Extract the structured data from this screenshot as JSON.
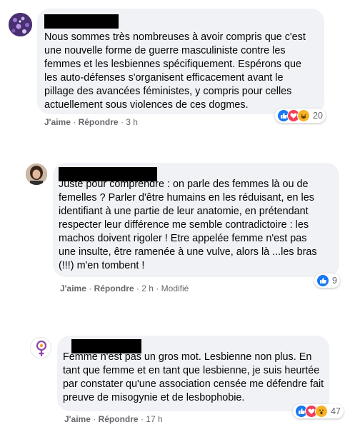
{
  "comments": [
    {
      "text": "Nous sommes très nombreuses à avoir compris que c'est\nune nouvelle forme de guerre masculiniste contre les\nfemmes et les lesbiennes spécifiquement. Espérons que\nles auto-défenses s'organisent efficacement avant le\npillage des avancées féministes, y compris pour celles\nactuellement sous violences de ces dogmes.",
      "like": "J'aime",
      "reply": "Répondre",
      "time": "3 h",
      "sep": "·",
      "reaction_count": "20",
      "reactions": [
        "like-icon",
        "love-icon",
        "haha-icon"
      ]
    },
    {
      "text": "Juste pour comprendre : on parle des femmes là ou de\nfemelles ? Parler d'être humains en les réduisant, en les\nidentifiant à une partie de leur anatomie, en prétendant\nrespecter leur différence me semble contradictoire : les\nmachos doivent rigoler ! Etre appelée femme n'est pas\nune insulte, être ramenée à une vulve, alors là ...les bras\n(!!!) m'en tombent !",
      "like": "J'aime",
      "reply": "Répondre",
      "time": "2 h",
      "edited": "Modifié",
      "sep": "·",
      "reaction_count": "9",
      "reactions": [
        "like-icon"
      ]
    },
    {
      "text": "Femme n'est pas un gros mot. Lesbienne non plus. En\ntant que femme et en tant que lesbienne, je suis heurtée\npar constater qu'une association censée me défendre fait\npreuve de misogynie et de lesbophobie.",
      "like": "J'aime",
      "reply": "Répondre",
      "time": "17 h",
      "sep": "·",
      "reaction_count": "47",
      "reactions": [
        "like-icon",
        "love-icon",
        "wow-icon"
      ]
    }
  ],
  "colors": {
    "bubble": "#f0f2f5",
    "meta": "#65676b",
    "like": "#1877f2",
    "love": "#f33e58",
    "haha": "#f7b125"
  }
}
